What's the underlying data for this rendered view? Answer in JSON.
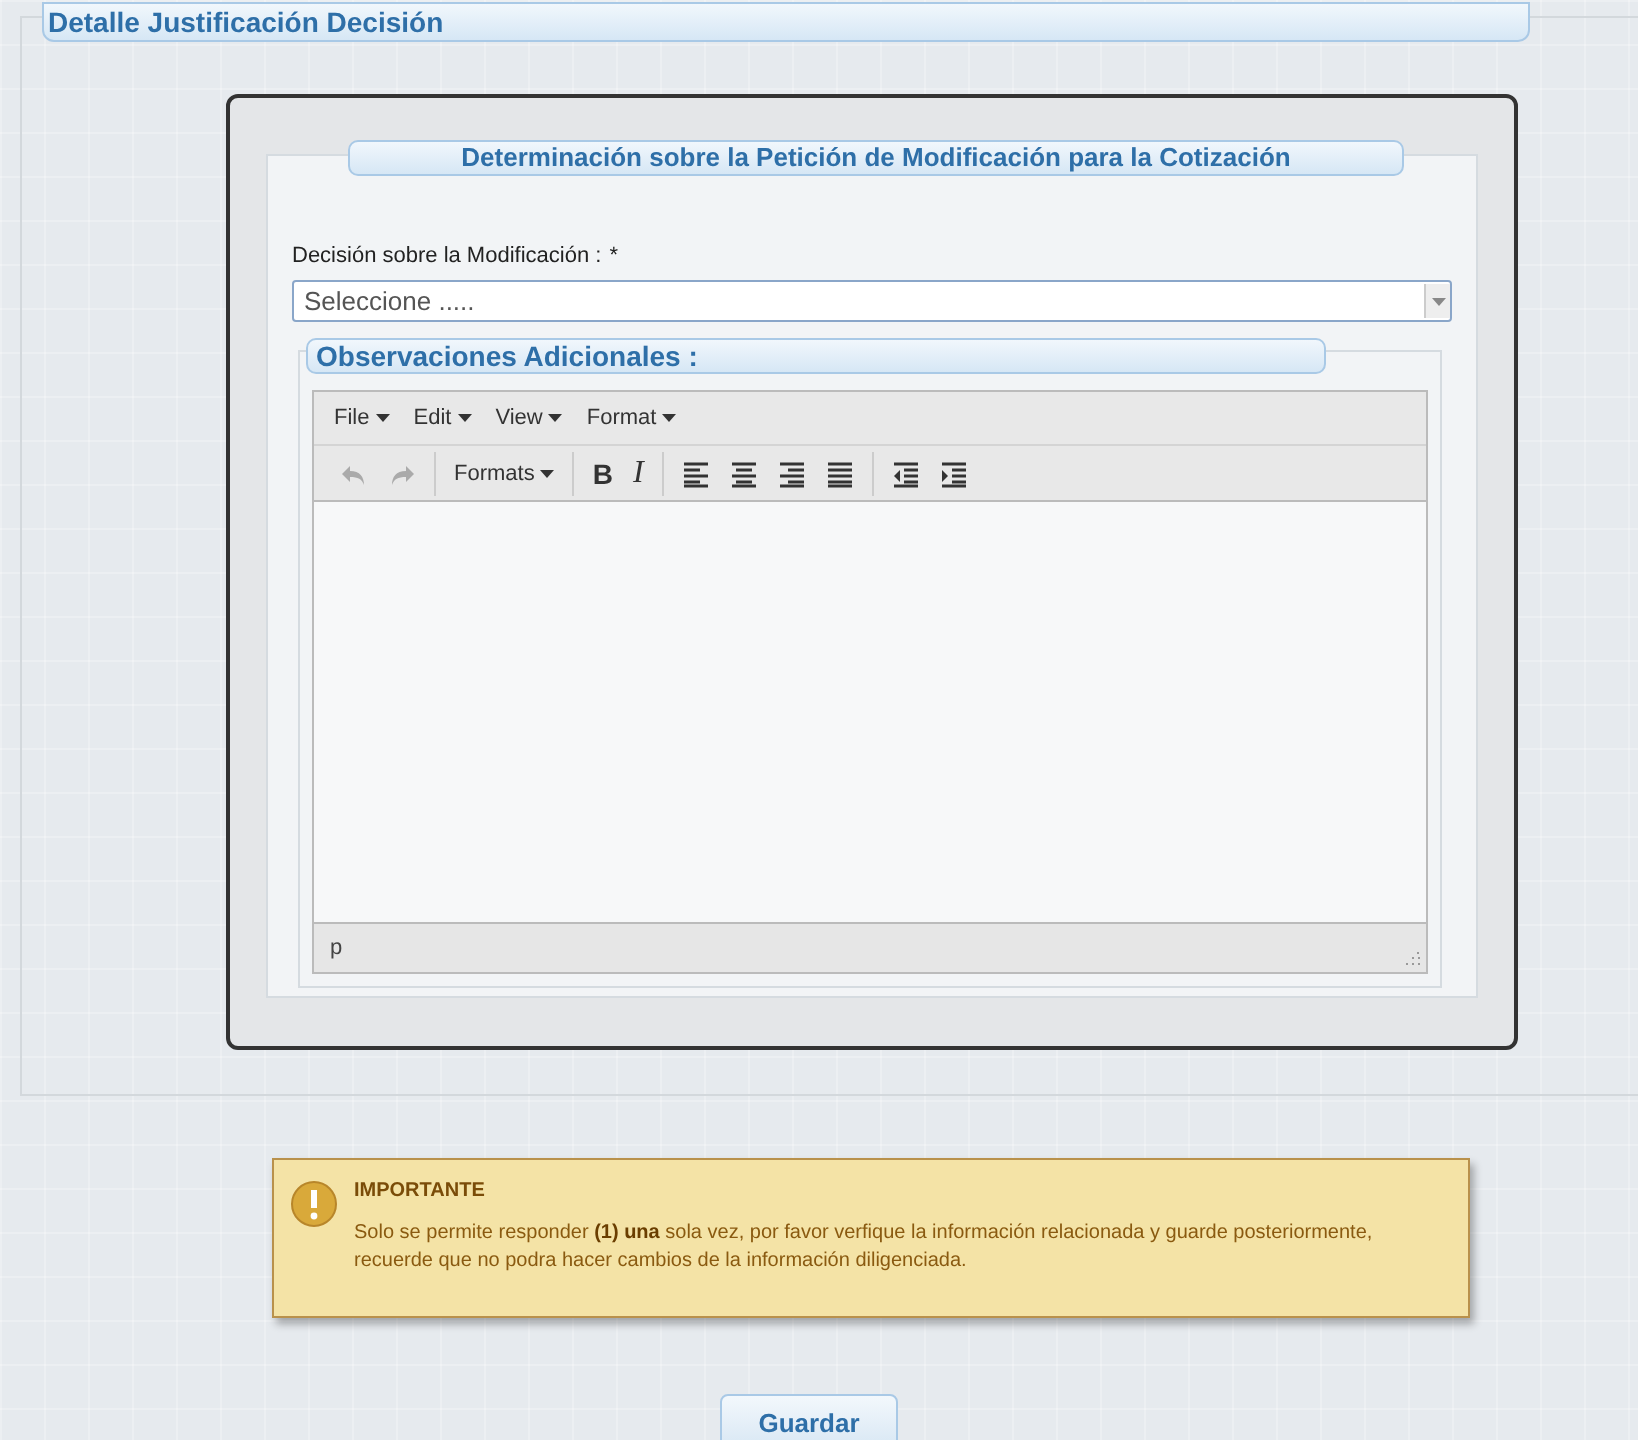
{
  "section": {
    "title": "Detalle Justificación Decisión"
  },
  "form": {
    "title": "Determinación sobre la Petición de Modificación para la Cotización",
    "decision": {
      "label": "Decisión sobre la Modificación :",
      "required_mark": "*",
      "value": "Seleccione ....."
    },
    "observations": {
      "title": "Observaciones Adicionales :",
      "editor": {
        "menus": [
          "File",
          "Edit",
          "View",
          "Format"
        ],
        "toolbar": [
          [
            {
              "kind": "icon",
              "disabled": true
            },
            {
              "kind": "icon",
              "disabled": true
            }
          ],
          [
            {
              "kind": "menu",
              "label": "Formats",
              "disabled": false
            }
          ],
          [
            {
              "kind": "glyph",
              "label": "B",
              "disabled": false
            },
            {
              "kind": "glyph",
              "label": "I",
              "disabled": false
            }
          ],
          [
            {
              "kind": "icon",
              "disabled": false
            },
            {
              "kind": "icon",
              "disabled": false
            },
            {
              "kind": "icon",
              "disabled": false
            },
            {
              "kind": "icon",
              "disabled": false
            }
          ],
          [
            {
              "kind": "icon",
              "disabled": false
            },
            {
              "kind": "icon",
              "disabled": false
            }
          ]
        ],
        "path": "p"
      }
    }
  },
  "notice": {
    "title": "IMPORTANTE",
    "text": "Solo se permite responder **(1) una** sola vez, por favor verfique la información relacionada y guarde posteriormente, recuerde que no podra hacer cambios de la información diligenciada."
  },
  "buttons": [
    "Guardar"
  ]
}
